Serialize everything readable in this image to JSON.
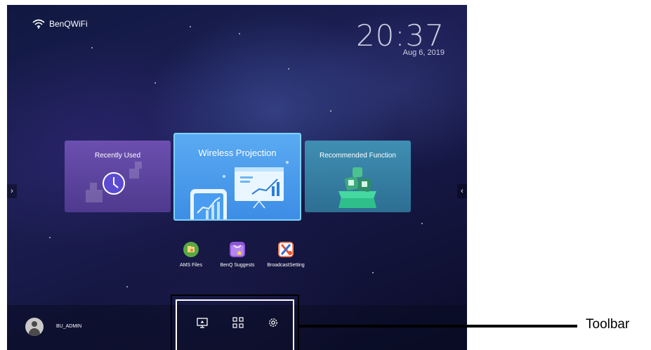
{
  "status": {
    "wifi_name": "BenQWiFi"
  },
  "clock": {
    "time": "20:37",
    "date": "Aug 6, 2019"
  },
  "cards": [
    {
      "title": "Recently Used"
    },
    {
      "title": "Wireless Projection"
    },
    {
      "title": "Recommended Function"
    }
  ],
  "apps": [
    {
      "label": "AMS Files",
      "icon": "ams-files-icon",
      "color": "#5aa843"
    },
    {
      "label": "BenQ Suggests",
      "icon": "benq-suggests-icon",
      "color": "#8e56d6"
    },
    {
      "label": "BroadcastSetting",
      "icon": "broadcast-setting-icon",
      "color": "#e8552f"
    }
  ],
  "user": {
    "name": "BU_ADMIN"
  },
  "toolbar": {
    "icons": [
      "screen-input-icon",
      "apps-grid-icon",
      "settings-gear-icon"
    ]
  },
  "annotation": {
    "label": "Toolbar"
  },
  "colors": {
    "accent": "#4a9cf0",
    "recently_used": "#5d45a0",
    "recommended": "#3a82a6"
  }
}
